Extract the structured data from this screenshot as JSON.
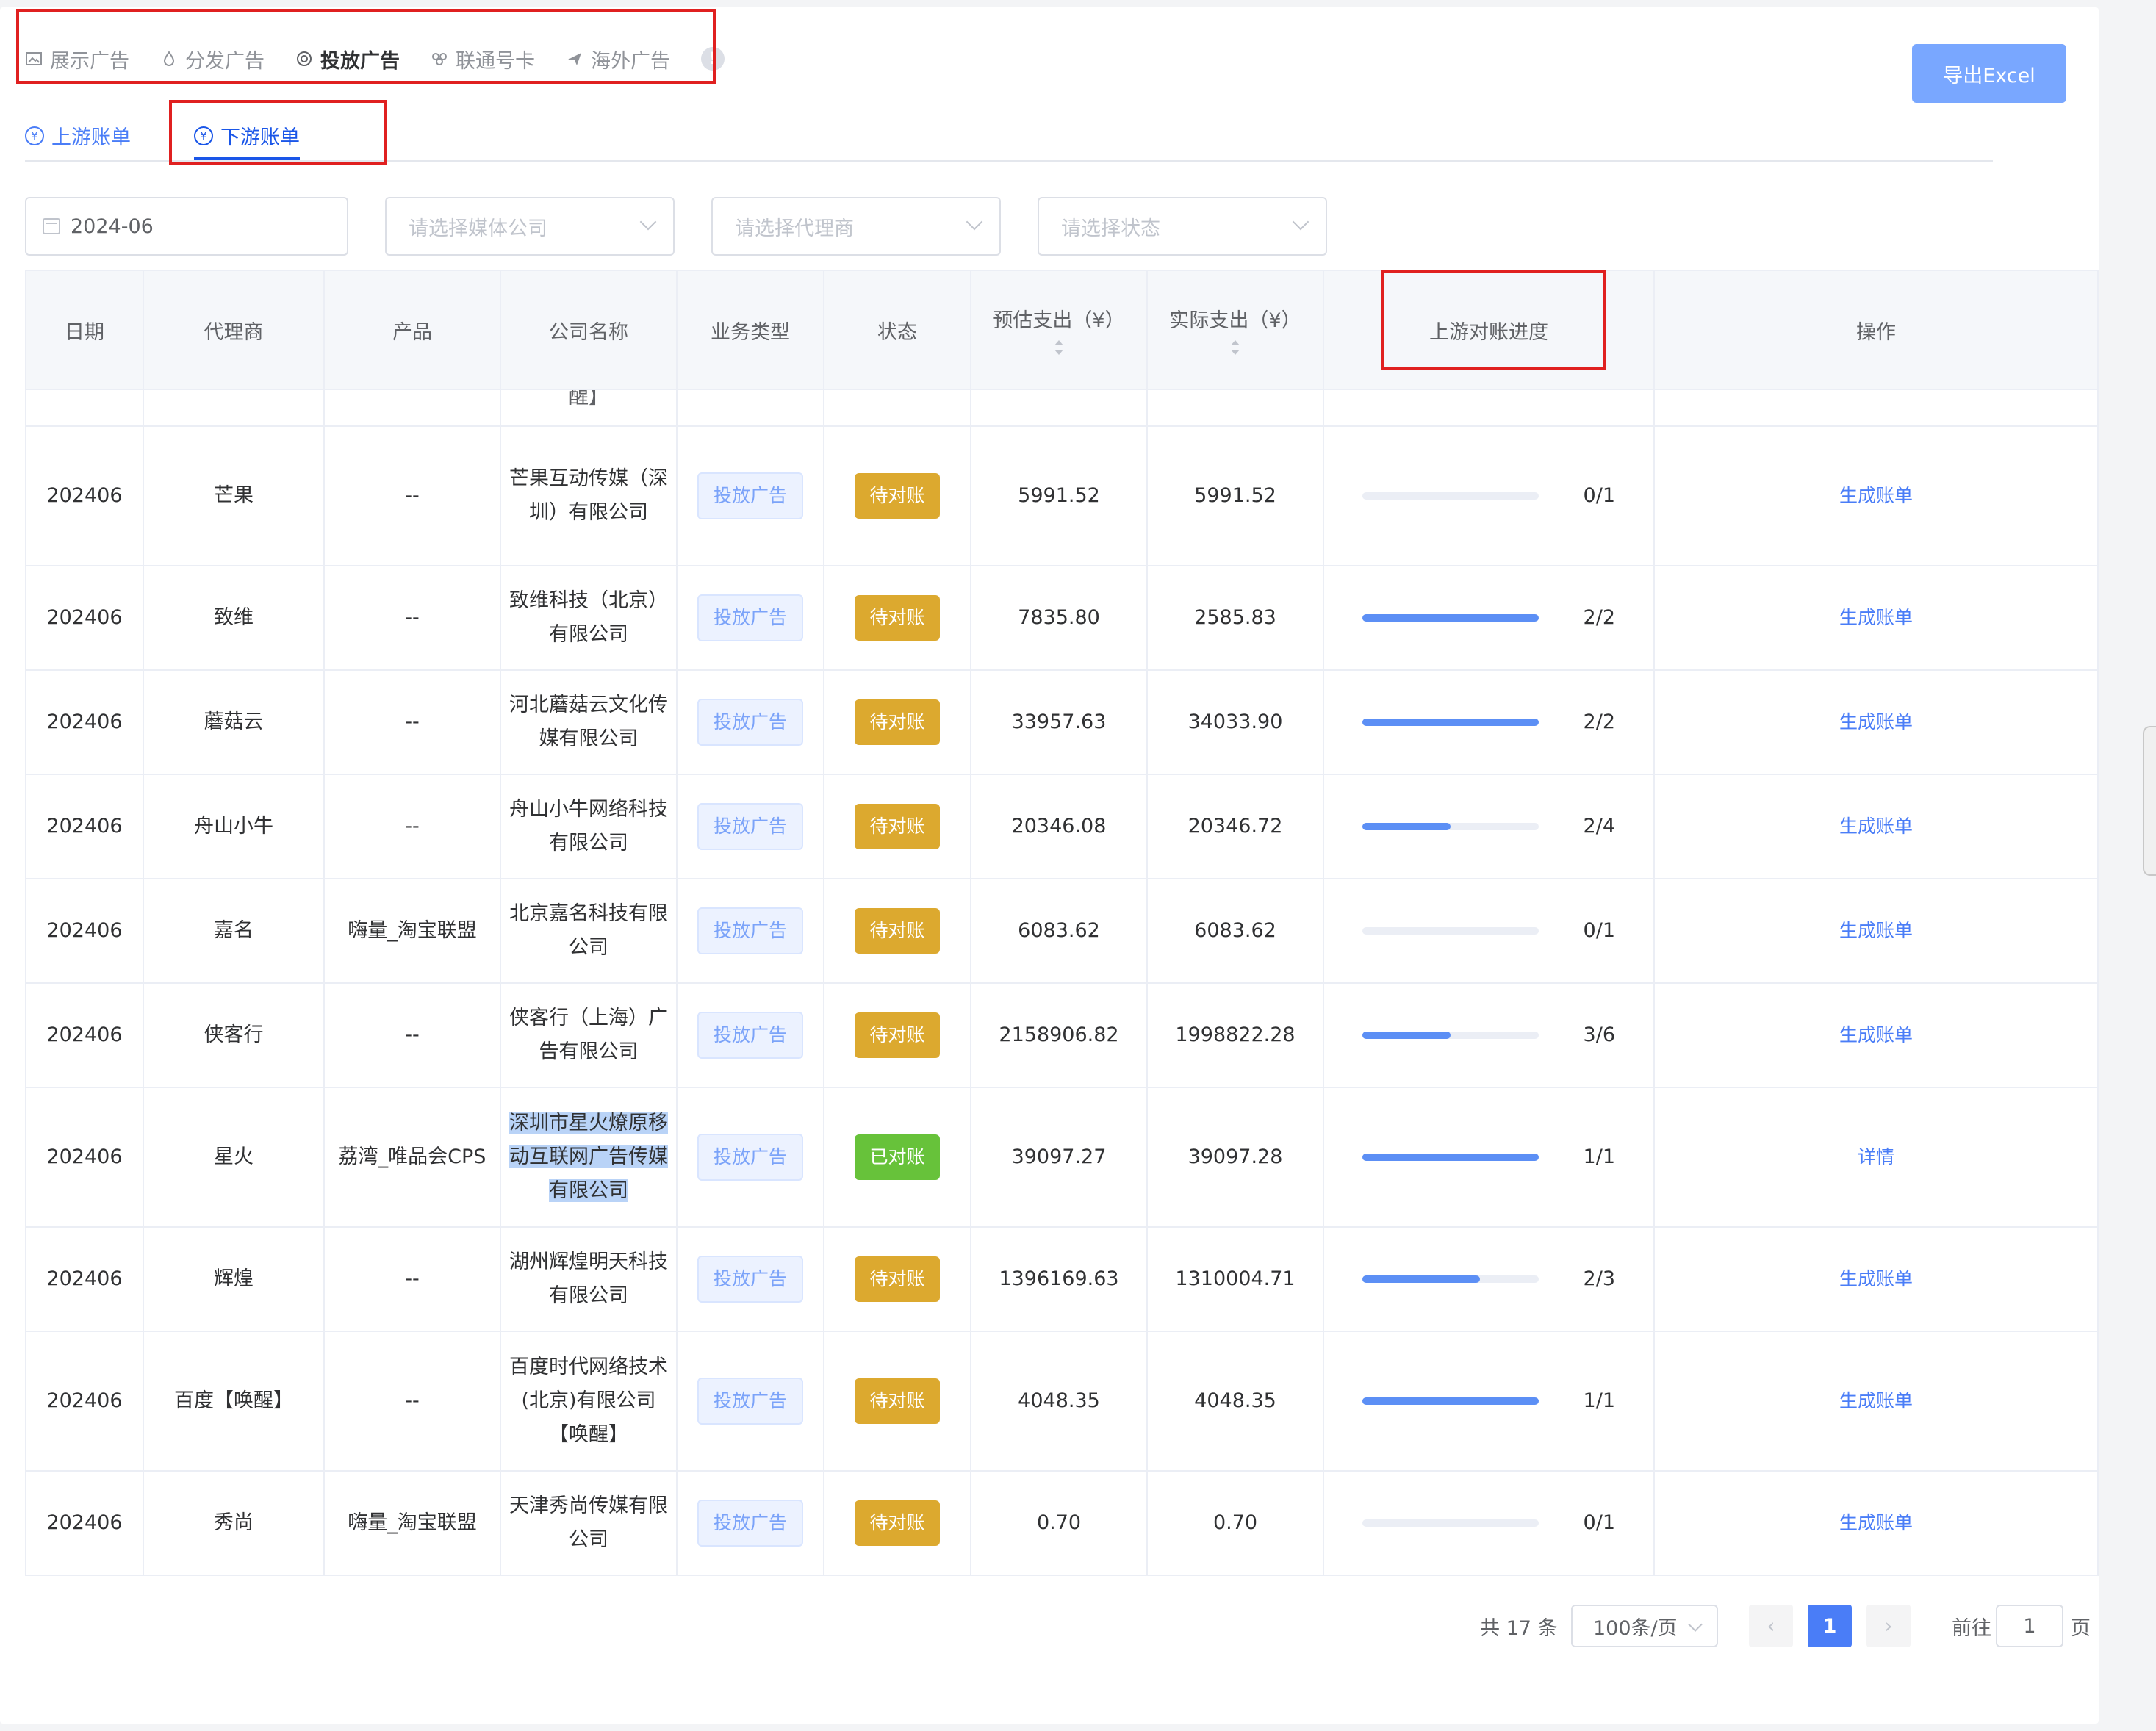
{
  "biz_tabs": [
    {
      "label": "展示广告",
      "icon": "image-icon"
    },
    {
      "label": "分发广告",
      "icon": "drop-icon"
    },
    {
      "label": "投放广告",
      "icon": "target-icon",
      "active": true
    },
    {
      "label": "联通号卡",
      "icon": "unicom-icon"
    },
    {
      "label": "海外广告",
      "icon": "plane-icon"
    }
  ],
  "info_mark": "!",
  "export_label": "导出Excel",
  "sub_tabs": [
    {
      "label": "上游账单",
      "icon": "yen-coin-icon"
    },
    {
      "label": "下游账单",
      "icon": "yen-coin-icon",
      "active": true
    }
  ],
  "coin_glyph": "¥",
  "filters": {
    "month": "2024-06",
    "media_placeholder": "请选择媒体公司",
    "agent_placeholder": "请选择代理商",
    "status_placeholder": "请选择状态"
  },
  "table": {
    "headers": {
      "date": "日期",
      "agent": "代理商",
      "product": "产品",
      "company": "公司名称",
      "biz_type": "业务类型",
      "status": "状态",
      "est": "预估支出（¥）",
      "actual": "实际支出（¥）",
      "progress": "上游对账进度",
      "ops": "操作"
    },
    "partial_row_text": "醒】",
    "rows": [
      {
        "date": "202406",
        "agent": "芒果",
        "product": "--",
        "company": "芒果互动传媒（深圳）有限公司",
        "type": "投放广告",
        "status": "待对账",
        "est": "5991.52",
        "actual": "5991.52",
        "done": 0,
        "total": 1,
        "progress": "0/1",
        "op": "生成账单"
      },
      {
        "date": "202406",
        "agent": "致维",
        "product": "--",
        "company": "致维科技（北京）有限公司",
        "type": "投放广告",
        "status": "待对账",
        "est": "7835.80",
        "actual": "2585.83",
        "done": 2,
        "total": 2,
        "progress": "2/2",
        "op": "生成账单"
      },
      {
        "date": "202406",
        "agent": "蘑菇云",
        "product": "--",
        "company": "河北蘑菇云文化传媒有限公司",
        "type": "投放广告",
        "status": "待对账",
        "est": "33957.63",
        "actual": "34033.90",
        "done": 2,
        "total": 2,
        "progress": "2/2",
        "op": "生成账单"
      },
      {
        "date": "202406",
        "agent": "舟山小牛",
        "product": "--",
        "company": "舟山小牛网络科技有限公司",
        "type": "投放广告",
        "status": "待对账",
        "est": "20346.08",
        "actual": "20346.72",
        "done": 2,
        "total": 4,
        "progress": "2/4",
        "op": "生成账单"
      },
      {
        "date": "202406",
        "agent": "嘉名",
        "product": "嗨量_淘宝联盟",
        "company": "北京嘉名科技有限公司",
        "type": "投放广告",
        "status": "待对账",
        "est": "6083.62",
        "actual": "6083.62",
        "done": 0,
        "total": 1,
        "progress": "0/1",
        "op": "生成账单"
      },
      {
        "date": "202406",
        "agent": "侠客行",
        "product": "--",
        "company": "侠客行（上海）广告有限公司",
        "type": "投放广告",
        "status": "待对账",
        "est": "2158906.82",
        "actual": "1998822.28",
        "done": 3,
        "total": 6,
        "progress": "3/6",
        "op": "生成账单"
      },
      {
        "date": "202406",
        "agent": "星火",
        "product": "荔湾_唯品会CPS",
        "company": "深圳市星火燎原移动互联网广告传媒有限公司",
        "type": "投放广告",
        "status": "已对账",
        "est": "39097.27",
        "actual": "39097.28",
        "done": 1,
        "total": 1,
        "progress": "1/1",
        "op": "详情"
      },
      {
        "date": "202406",
        "agent": "辉煌",
        "product": "--",
        "company": "湖州辉煌明天科技有限公司",
        "type": "投放广告",
        "status": "待对账",
        "est": "1396169.63",
        "actual": "1310004.71",
        "done": 2,
        "total": 3,
        "progress": "2/3",
        "op": "生成账单"
      },
      {
        "date": "202406",
        "agent": "百度【唤醒】",
        "product": "--",
        "company": "百度时代网络技术(北京)有限公司【唤醒】",
        "type": "投放广告",
        "status": "待对账",
        "est": "4048.35",
        "actual": "4048.35",
        "done": 1,
        "total": 1,
        "progress": "1/1",
        "op": "生成账单"
      },
      {
        "date": "202406",
        "agent": "秀尚",
        "product": "嗨量_淘宝联盟",
        "company": "天津秀尚传媒有限公司",
        "type": "投放广告",
        "status": "待对账",
        "est": "0.70",
        "actual": "0.70",
        "done": 0,
        "total": 1,
        "progress": "0/1",
        "op": "生成账单"
      }
    ]
  },
  "pagination": {
    "total": "共 17 条",
    "page_size": "100条/页",
    "prev": "‹",
    "current_page": "1",
    "next": "›",
    "goto_prefix": "前往",
    "goto_value": "1",
    "goto_suffix": "页"
  },
  "colors": {
    "accent": "#4a7df7",
    "pending": "#dca92f",
    "done": "#67c23a",
    "annotation": "#e02020"
  }
}
